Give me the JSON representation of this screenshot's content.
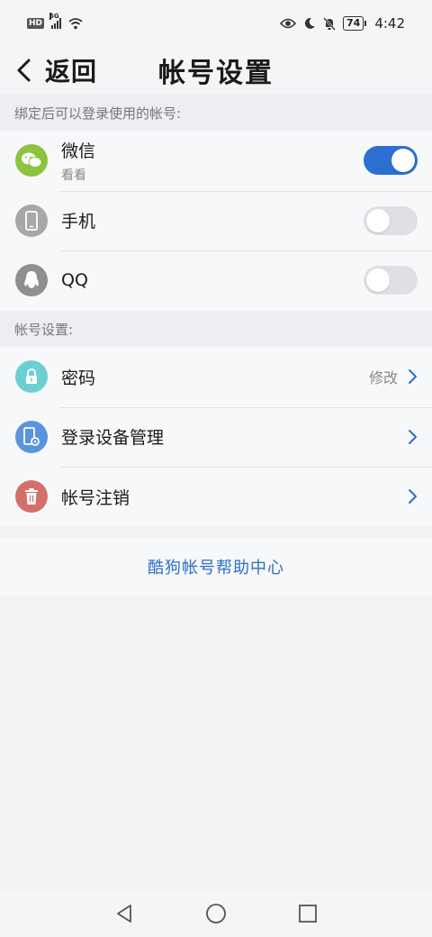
{
  "status_bar": {
    "hd": "HD",
    "network": "5G",
    "battery": "74",
    "time": "4:42"
  },
  "header": {
    "back_label": "返回",
    "title": "帐号设置"
  },
  "bound_section": {
    "title": "绑定后可以登录使用的帐号:",
    "items": [
      {
        "label": "微信",
        "sub": "看看",
        "enabled": true,
        "icon": "wechat-icon",
        "color": "#8cc33f"
      },
      {
        "label": "手机",
        "enabled": false,
        "icon": "phone-icon",
        "color": "#a7a7a7"
      },
      {
        "label": "QQ",
        "enabled": false,
        "icon": "qq-icon",
        "color": "#8f8f8f"
      }
    ]
  },
  "account_section": {
    "title": "帐号设置:",
    "items": [
      {
        "label": "密码",
        "value": "修改",
        "icon": "lock-icon",
        "color": "#6ccfd3"
      },
      {
        "label": "登录设备管理",
        "icon": "device-settings-icon",
        "color": "#5a93de"
      },
      {
        "label": "帐号注销",
        "icon": "trash-icon",
        "color": "#d3706c"
      }
    ]
  },
  "help": {
    "label": "酷狗帐号帮助中心"
  },
  "colors": {
    "accent": "#2d6fd1",
    "link": "#2d6fc4"
  }
}
